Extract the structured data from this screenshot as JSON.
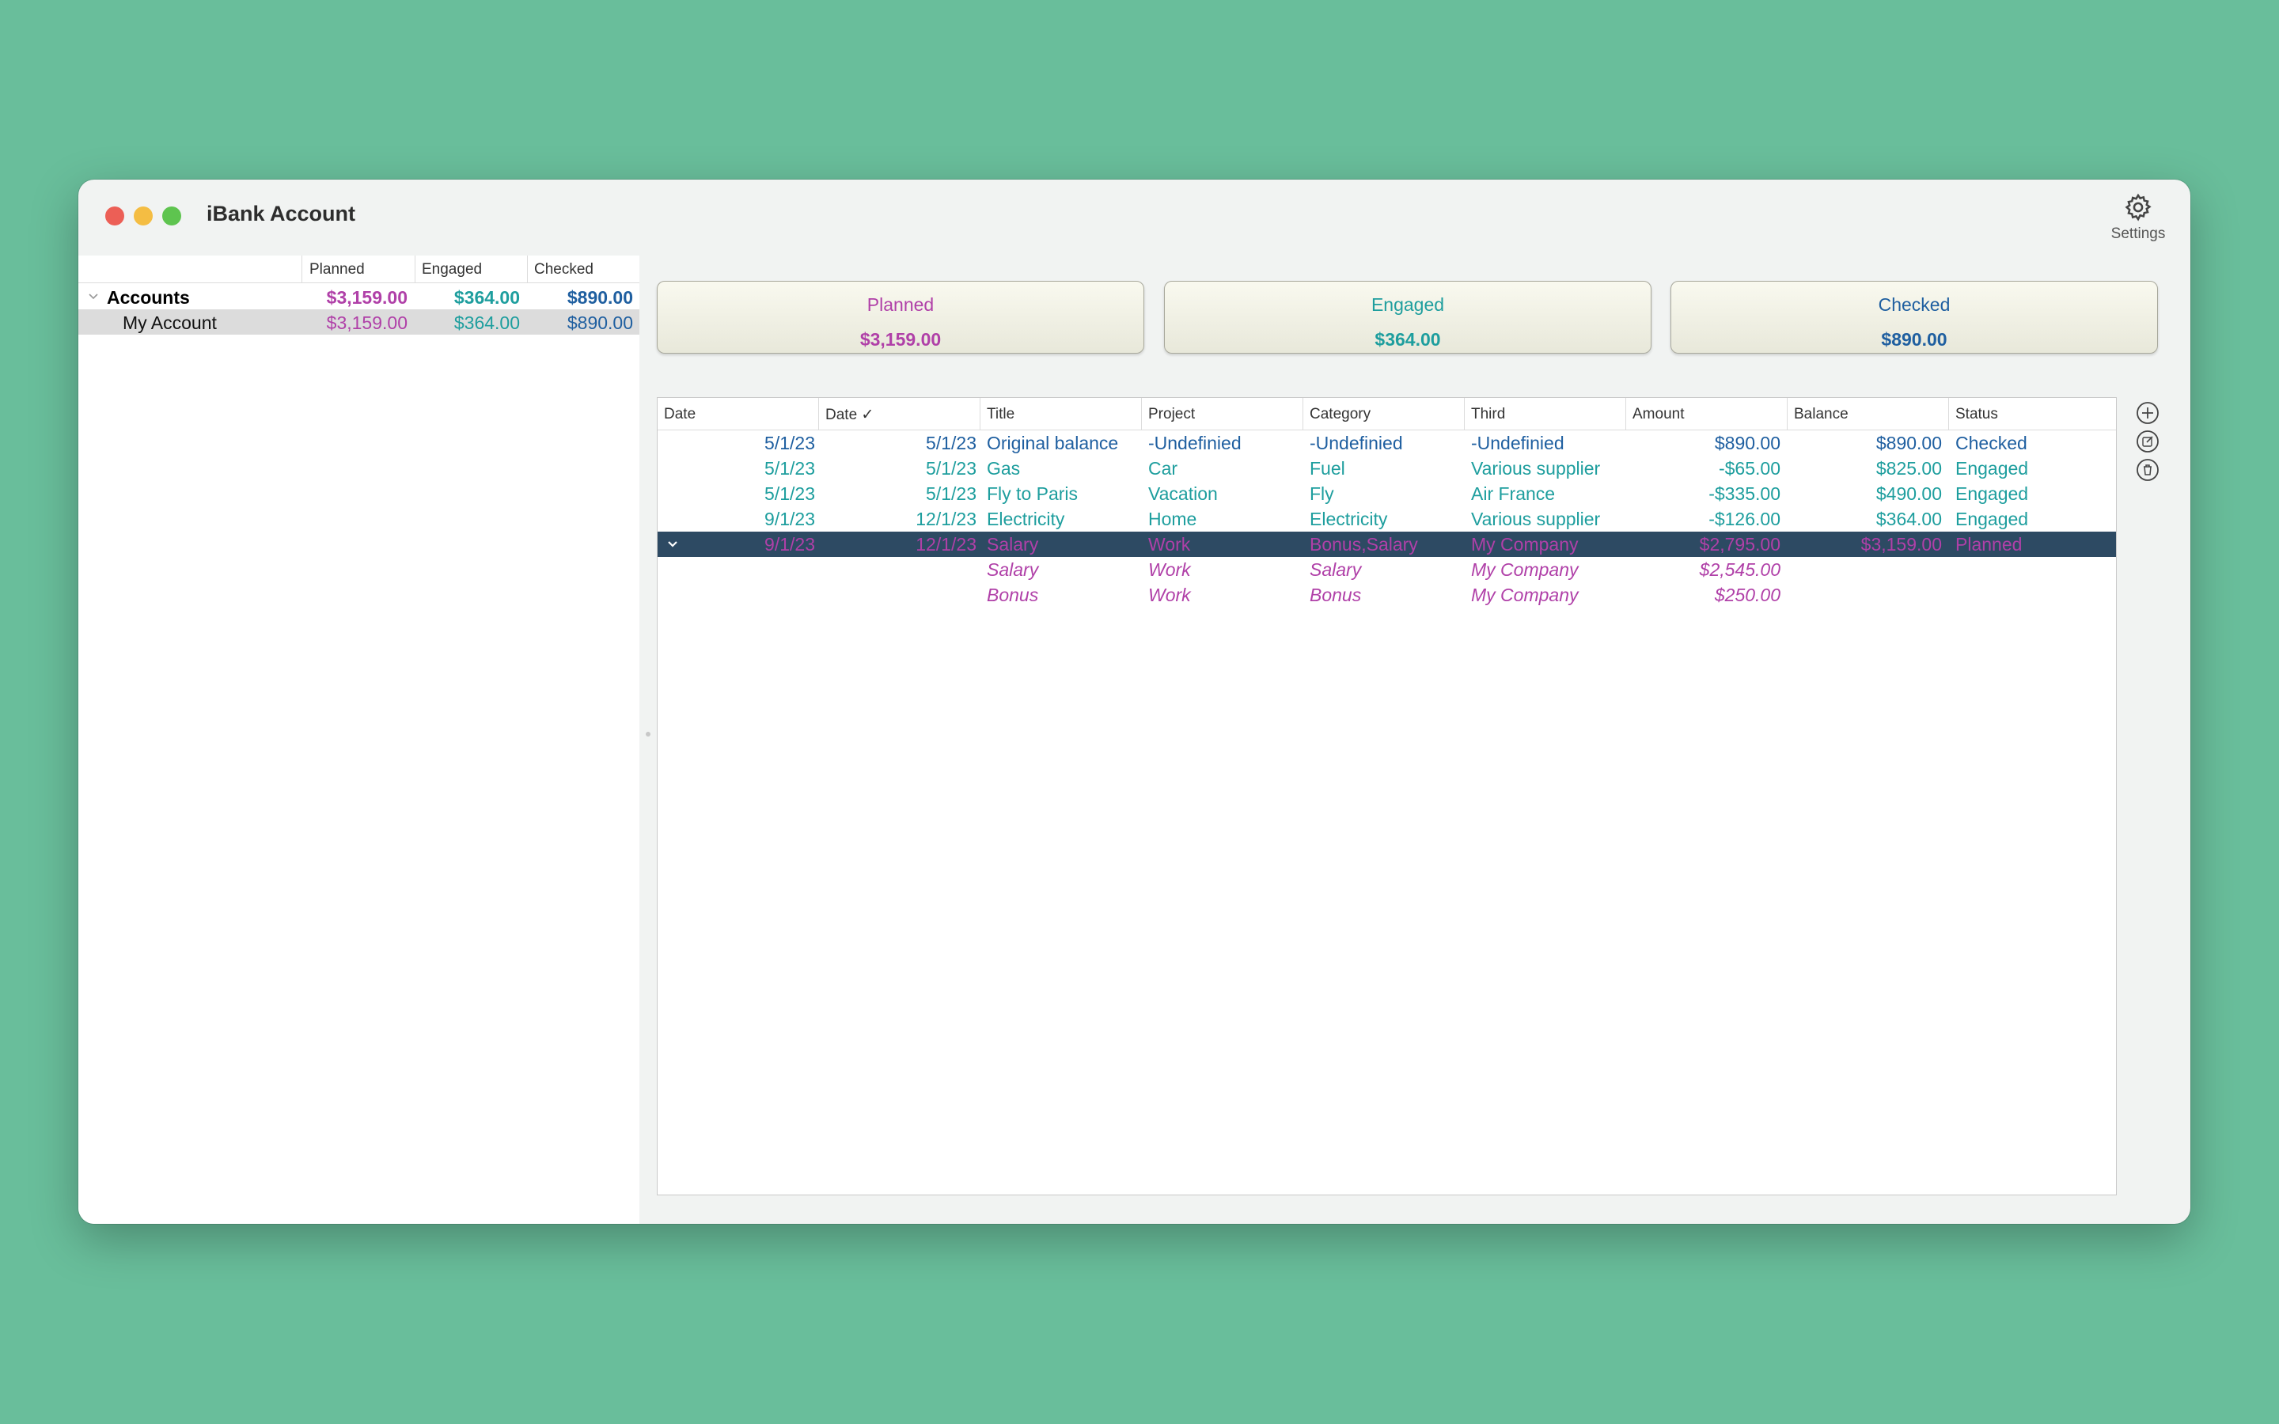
{
  "colors": {
    "planned": "#b040a8",
    "engaged": "#1e9e9e",
    "checked": "#1f5fa0",
    "selection": "#2d4a63"
  },
  "window": {
    "title": "iBank Account"
  },
  "toolbar": {
    "settings_label": "Settings",
    "settings_icon": "gear-icon"
  },
  "sidebar": {
    "headers": [
      "Planned",
      "Engaged",
      "Checked"
    ],
    "group": {
      "name": "Accounts",
      "planned": "$3,159.00",
      "engaged": "$364.00",
      "checked": "$890.00"
    },
    "accounts": [
      {
        "name": "My Account",
        "planned": "$3,159.00",
        "engaged": "$364.00",
        "checked": "$890.00"
      }
    ]
  },
  "summary": {
    "planned": {
      "label": "Planned",
      "value": "$3,159.00"
    },
    "engaged": {
      "label": "Engaged",
      "value": "$364.00"
    },
    "checked": {
      "label": "Checked",
      "value": "$890.00"
    }
  },
  "table": {
    "columns": [
      "Date",
      "Date ✓",
      "Title",
      "Project",
      "Category",
      "Third",
      "Amount",
      "Balance",
      "Status"
    ],
    "rows": [
      {
        "date": "5/1/23",
        "date_checked": "5/1/23",
        "title": "Original balance",
        "project": "-Undefinied",
        "category": "-Undefinied",
        "third": "-Undefinied",
        "amount": "$890.00",
        "balance": "$890.00",
        "status": "Checked"
      },
      {
        "date": "5/1/23",
        "date_checked": "5/1/23",
        "title": "Gas",
        "project": "Car",
        "category": "Fuel",
        "third": "Various supplier",
        "amount": "-$65.00",
        "balance": "$825.00",
        "status": "Engaged"
      },
      {
        "date": "5/1/23",
        "date_checked": "5/1/23",
        "title": "Fly to Paris",
        "project": "Vacation",
        "category": "Fly",
        "third": "Air France",
        "amount": "-$335.00",
        "balance": "$490.00",
        "status": "Engaged"
      },
      {
        "date": "9/1/23",
        "date_checked": "12/1/23",
        "title": "Electricity",
        "project": "Home",
        "category": "Electricity",
        "third": "Various supplier",
        "amount": "-$126.00",
        "balance": "$364.00",
        "status": "Engaged"
      },
      {
        "date": "9/1/23",
        "date_checked": "12/1/23",
        "title": "Salary",
        "project": "Work",
        "category": "Bonus,Salary",
        "third": "My Company",
        "amount": "$2,795.00",
        "balance": "$3,159.00",
        "status": "Planned"
      }
    ],
    "splits": [
      {
        "title": "Salary",
        "project": "Work",
        "category": "Salary",
        "third": "My Company",
        "amount": "$2,545.00"
      },
      {
        "title": "Bonus",
        "project": "Work",
        "category": "Bonus",
        "third": "My Company",
        "amount": "$250.00"
      }
    ]
  },
  "actions": [
    "add-icon",
    "edit-icon",
    "trash-icon"
  ]
}
